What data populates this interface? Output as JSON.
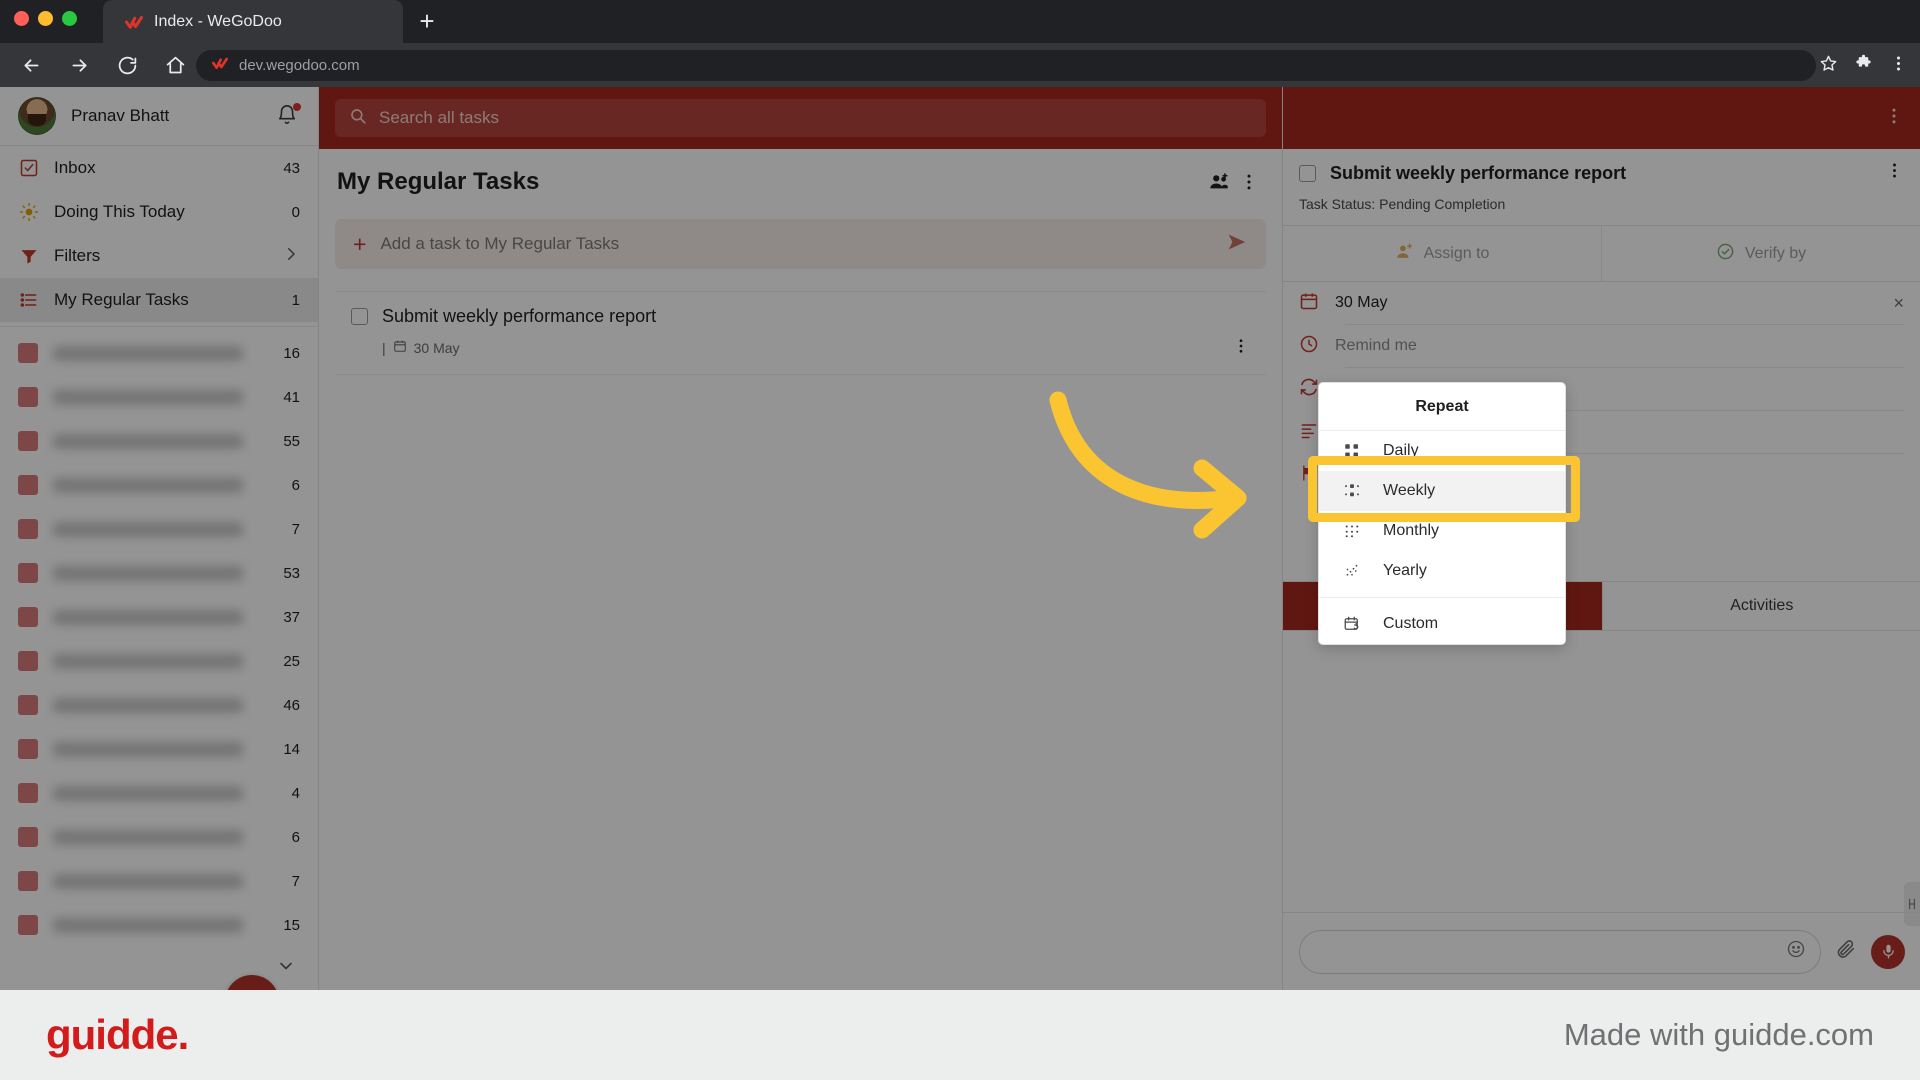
{
  "browser": {
    "tab_title": "Index - WeGoDoo",
    "new_tab_label": "+",
    "url": "dev.wegodoo.com",
    "back_icon": "back-arrow-icon",
    "forward_icon": "forward-arrow-icon",
    "reload_icon": "reload-icon",
    "home_icon": "home-icon",
    "star_icon": "bookmark-star-icon",
    "extensions_icon": "extensions-puzzle-icon",
    "menu_icon": "browser-menu-icon"
  },
  "sidebar": {
    "user_name": "Pranav Bhatt",
    "nav": [
      {
        "label": "Inbox",
        "count": "43",
        "icon": "inbox-checkbox-icon",
        "active": false
      },
      {
        "label": "Doing This Today",
        "count": "0",
        "icon": "sun-icon",
        "active": false
      },
      {
        "label": "Filters",
        "count": "",
        "icon": "filter-funnel-icon",
        "active": false,
        "chevron": true
      },
      {
        "label": "My Regular Tasks",
        "count": "1",
        "icon": "list-icon",
        "active": true
      }
    ],
    "projects": [
      {
        "count": "16"
      },
      {
        "count": "41"
      },
      {
        "count": "55"
      },
      {
        "count": "6"
      },
      {
        "count": "7"
      },
      {
        "count": "53"
      },
      {
        "count": "37"
      },
      {
        "count": "25"
      },
      {
        "count": "46"
      },
      {
        "count": "14"
      },
      {
        "count": "4"
      },
      {
        "count": "6"
      },
      {
        "count": "7"
      },
      {
        "count": "15"
      }
    ],
    "add_button_label": "+",
    "expand_more_icon": "chevron-down-icon"
  },
  "search": {
    "placeholder": "Search all tasks",
    "icon": "search-icon",
    "kebab_icon": "more-vertical-icon"
  },
  "task_list": {
    "title": "My Regular Tasks",
    "share_icon": "add-people-icon",
    "kebab_icon": "more-vertical-icon",
    "add_task_placeholder": "Add a task to My Regular Tasks",
    "add_plus": "+",
    "send_icon": "send-icon",
    "tasks": [
      {
        "name": "Submit weekly performance report",
        "date": "30 May",
        "date_icon": "calendar-icon",
        "kebab_icon": "more-vertical-icon"
      }
    ]
  },
  "detail": {
    "kebab_icon": "more-vertical-icon",
    "title": "Submit weekly performance report",
    "status": "Task Status: Pending Completion",
    "assign_to_label": "Assign to",
    "assign_to_icon": "person-add-icon",
    "verify_by_label": "Verify by",
    "verify_by_icon": "verified-check-icon",
    "fields": [
      {
        "label": "30 May",
        "icon": "calendar-icon",
        "muted": false,
        "clear": "×"
      },
      {
        "label": "Remind me",
        "icon": "clock-icon",
        "muted": true,
        "clear": ""
      },
      {
        "label": "Repeat",
        "icon": "repeat-icon",
        "muted": true,
        "clear": ""
      },
      {
        "label": "",
        "icon": "description-icon",
        "muted": true,
        "clear": ""
      },
      {
        "label": "",
        "icon": "flag-icon",
        "muted": true,
        "clear": ""
      }
    ],
    "tabs": [
      {
        "label": "",
        "accent": true
      },
      {
        "label": "Activities",
        "accent": false
      }
    ],
    "comment_emoji_icon": "emoji-smiley-icon",
    "comment_attach_icon": "paperclip-icon",
    "comment_mic_icon": "microphone-icon",
    "side_handle_icon": "resize-handle-icon"
  },
  "repeat_dropdown": {
    "title": "Repeat",
    "items": [
      {
        "label": "Daily",
        "icon": "daily-grid-icon",
        "highlighted": false
      },
      {
        "label": "Weekly",
        "icon": "weekly-grid-icon",
        "highlighted": true
      },
      {
        "label": "Monthly",
        "icon": "monthly-grid-icon",
        "highlighted": false
      },
      {
        "label": "Yearly",
        "icon": "yearly-scatter-icon",
        "highlighted": false
      }
    ],
    "custom": {
      "label": "Custom",
      "icon": "custom-calendar-icon"
    }
  },
  "annotations": {
    "arrow_icon": "curved-arrow-right-icon",
    "arrow_color": "#fbc531",
    "highlight_color": "#fbc531"
  },
  "footer": {
    "brand": "guidde.",
    "made_with": "Made with guidde.com",
    "brand_color": "#d31b1b"
  },
  "colors": {
    "accent_red": "#a8291e",
    "brand_red": "#b3332a",
    "chrome_dark": "#202124",
    "highlight_yellow": "#fbc531"
  }
}
